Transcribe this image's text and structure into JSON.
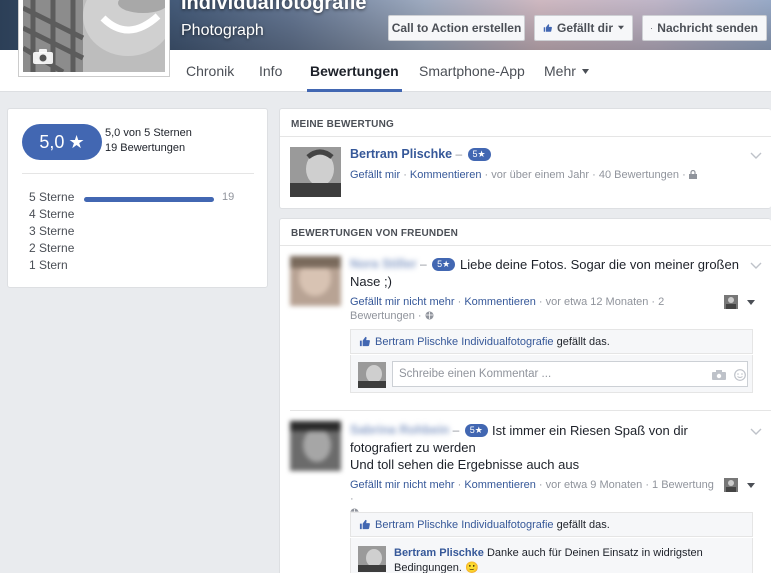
{
  "header": {
    "page_name": "Individualfotografie",
    "category": "Photograph",
    "buttons": {
      "cta": "Call to Action erstellen",
      "liked": "Gefällt dir",
      "message": "Nachricht senden"
    },
    "tabs": [
      "Chronik",
      "Info",
      "Bewertungen",
      "Smartphone-App",
      "Mehr"
    ],
    "active_tab": "Bewertungen"
  },
  "rating": {
    "score": "5,0",
    "star": "★",
    "of_stars": "5,0 von 5 Sternen",
    "count": "19 Bewertungen",
    "rows": [
      {
        "label": "5 Sterne",
        "fraction": 1.0,
        "count": "19"
      },
      {
        "label": "4 Sterne"
      },
      {
        "label": "3 Sterne"
      },
      {
        "label": "2 Sterne"
      },
      {
        "label": "1 Stern"
      }
    ]
  },
  "my_review": {
    "section_title": "MEINE BEWERTUNG",
    "name": "Bertram Plischke",
    "dash": "–",
    "badge": "5★",
    "like": "Gefällt mir",
    "comment": "Kommentieren",
    "dot": "·",
    "time": "vor über einem Jahr",
    "review_count": "40 Bewertungen"
  },
  "friends": {
    "section_title": "BEWERTUNGEN VON FREUNDEN",
    "reviews": [
      {
        "name": "Nora Stiller",
        "dash": "–",
        "badge": "5★",
        "text": "Liebe deine Fotos. Sogar die von meiner großen Nase ;)",
        "unlike": "Gefällt mir nicht mehr",
        "comment": "Kommentieren",
        "time": "vor etwa 12 Monaten",
        "likes": "2 Bewertungen",
        "liked_by": "Bertram Plischke Individualfotografie",
        "liked_suffix": "gefällt das.",
        "comment_placeholder": "Schreibe einen Kommentar ..."
      },
      {
        "name": "Sabrina Rohbein",
        "dash": "–",
        "badge": "5★",
        "text_line1": "Ist immer ein Riesen Spaß von dir fotografiert zu werden",
        "text_line2": "Und toll sehen die Ergebnisse auch aus",
        "unlike": "Gefällt mir nicht mehr",
        "comment": "Kommentieren",
        "time": "vor etwa 9 Monaten",
        "likes": "1 Bewertung",
        "liked_by": "Bertram Plischke Individualfotografie",
        "liked_suffix": "gefällt das.",
        "reply_name": "Bertram Plischke",
        "reply_text": "Danke auch für Deinen Einsatz in widrigsten Bedingungen.",
        "reply_emoji": "🙂"
      }
    ]
  },
  "colors": {
    "accent": "#4267b2",
    "link": "#365899",
    "meta": "#90949c",
    "background": "#e9ebee"
  },
  "icons": [
    "camera-icon",
    "thumbs-up-icon",
    "caret-down-icon",
    "message-icon",
    "lock-icon",
    "globe-icon",
    "chevron-down-icon",
    "emoji-icon",
    "people-icon"
  ]
}
